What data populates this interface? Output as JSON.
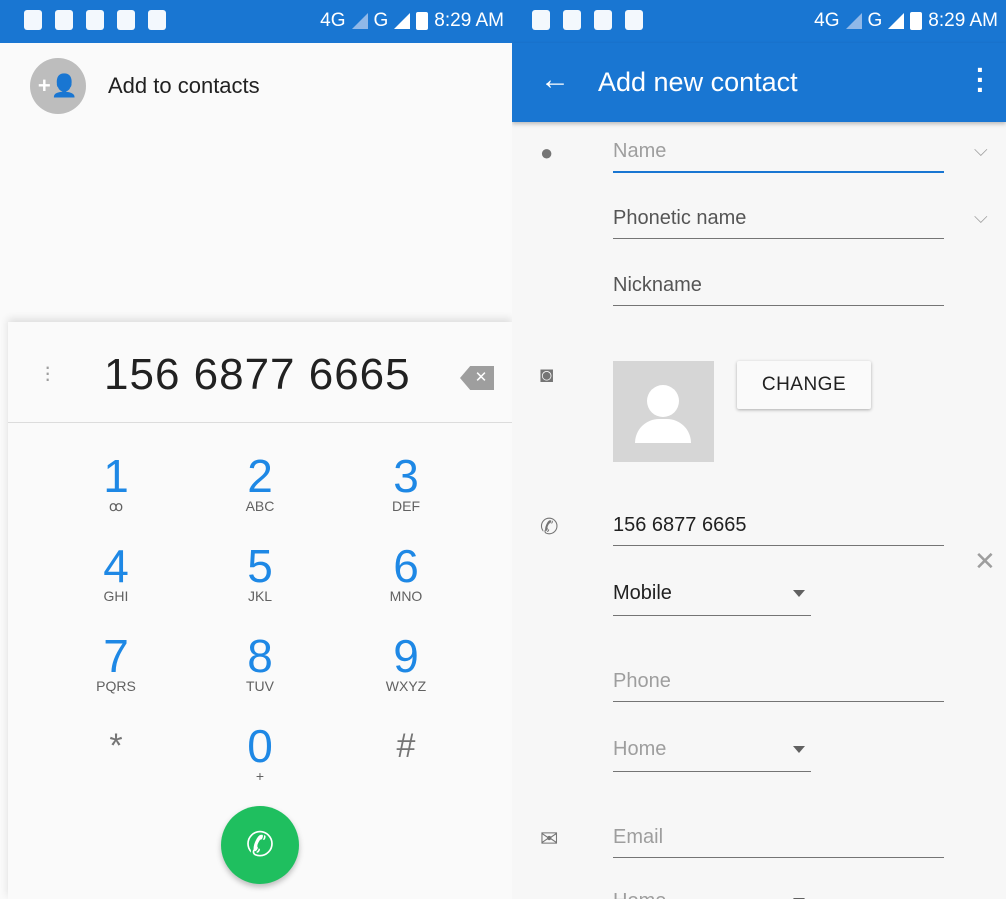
{
  "status": {
    "network": "4G",
    "network2": "G",
    "time": "8:29 AM"
  },
  "left": {
    "add_to_contacts": "Add to contacts",
    "dialed_number": "156 6877 6665",
    "keys": [
      {
        "digit": "1",
        "letters": "ꝏ"
      },
      {
        "digit": "2",
        "letters": "ABC"
      },
      {
        "digit": "3",
        "letters": "DEF"
      },
      {
        "digit": "4",
        "letters": "GHI"
      },
      {
        "digit": "5",
        "letters": "JKL"
      },
      {
        "digit": "6",
        "letters": "MNO"
      },
      {
        "digit": "7",
        "letters": "PQRS"
      },
      {
        "digit": "8",
        "letters": "TUV"
      },
      {
        "digit": "9",
        "letters": "WXYZ"
      },
      {
        "digit": "*",
        "letters": ""
      },
      {
        "digit": "0",
        "letters": "+"
      },
      {
        "digit": "#",
        "letters": ""
      }
    ]
  },
  "right": {
    "title": "Add new contact",
    "name_placeholder": "Name",
    "phonetic_placeholder": "Phonetic name",
    "nickname_placeholder": "Nickname",
    "change_label": "CHANGE",
    "phone_value": "156 6877 6665",
    "phone_type": "Mobile",
    "phone2_placeholder": "Phone",
    "phone2_type": "Home",
    "email_placeholder": "Email",
    "email_type": "Home"
  },
  "icons": [
    "sd-card-icon",
    "phone-icon",
    "message-icon",
    "usb-icon",
    "android-icon",
    "signal-icon",
    "battery-icon",
    "add-contact-icon",
    "overflow-menu-icon",
    "backspace-icon",
    "voicemail-icon",
    "call-icon",
    "back-arrow-icon",
    "person-icon",
    "camera-icon",
    "phone-icon",
    "email-icon",
    "chevron-down-icon",
    "clear-icon"
  ],
  "colors": {
    "primary": "#1976d2",
    "dial_digits": "#1e88e5",
    "call": "#1fbf5f"
  }
}
